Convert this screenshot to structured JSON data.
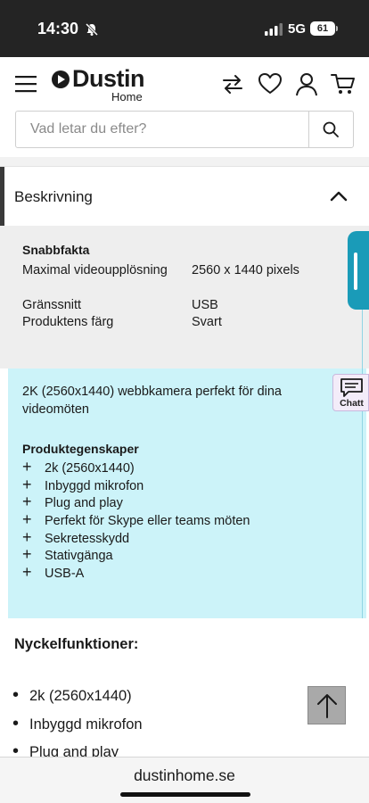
{
  "status_bar": {
    "time": "14:30",
    "network": "5G",
    "battery": "61"
  },
  "header": {
    "logo_text": "Dustin",
    "logo_sub": "Home"
  },
  "search": {
    "placeholder": "Vad letar du efter?"
  },
  "description": {
    "title": "Beskrivning",
    "quick_facts": {
      "title": "Snabbfakta",
      "rows": [
        {
          "label": "Maximal videoupplösning",
          "value": "2560 x 1440 pixels"
        },
        {
          "label": "Gränssnitt",
          "value": "USB"
        },
        {
          "label": "Produktens färg",
          "value": "Svart"
        }
      ]
    },
    "intro": "2K (2560x1440) webbkamera perfekt för dina videomöten",
    "features_heading": "Produktegenskaper",
    "features": [
      "2k (2560x1440)",
      "Inbyggd mikrofon",
      "Plug and play",
      "Perfekt för Skype eller teams möten",
      "Sekretesskydd",
      "Stativgänga",
      "USB-A"
    ]
  },
  "chat": {
    "label": "Chatt"
  },
  "key_features": {
    "title": "Nyckelfunktioner:",
    "items": [
      "2k (2560x1440)",
      "Inbyggd mikrofon",
      "Plug and play"
    ]
  },
  "browser": {
    "domain": "dustinhome.se"
  },
  "colors": {
    "feature_box_bg": "#ccf3f9",
    "side_tab": "#1a9bb8",
    "status_bar": "#242424"
  },
  "icons": [
    "bell-muted-icon",
    "signal-icon",
    "menu-icon",
    "compare-icon",
    "heart-icon",
    "user-icon",
    "cart-icon",
    "search-icon",
    "chevron-up-icon",
    "chat-icon",
    "arrow-up-icon"
  ]
}
